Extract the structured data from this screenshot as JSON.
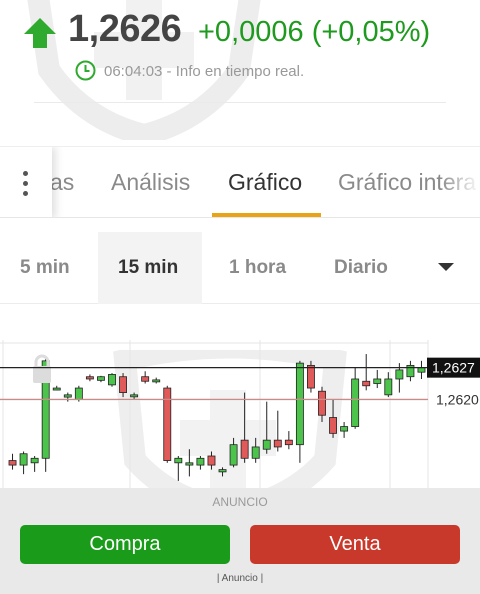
{
  "quote": {
    "price": "1,2626",
    "change": "+0,0006 (+0,05%)",
    "time": "06:04:03",
    "time_suffix": " - Info en tiempo real.",
    "trend_icon": "arrow-up-icon",
    "up_color": "#1e9a1e"
  },
  "tabs": {
    "items": [
      "as",
      "Análisis",
      "Gráfico",
      "Gráfico intera"
    ],
    "active": "Gráfico",
    "accent": "#e8a317"
  },
  "timeframes": {
    "items": [
      "5 min",
      "15 min",
      "1 hora",
      "Diario"
    ],
    "active": "15 min"
  },
  "chart_data": {
    "type": "candlestick",
    "price_labels": [
      "1,2627",
      "1,2620"
    ],
    "last_price": 1.2627,
    "reference_price": 1.262,
    "ylim": [
      1.26,
      1.2632
    ],
    "up_color": "#4cc44c",
    "down_color": "#e05a5a",
    "candles": [
      {
        "o": 1.26065,
        "h": 1.2608,
        "l": 1.26045,
        "c": 1.26055
      },
      {
        "o": 1.26055,
        "h": 1.26085,
        "l": 1.26035,
        "c": 1.2608
      },
      {
        "o": 1.2606,
        "h": 1.26075,
        "l": 1.2604,
        "c": 1.2607
      },
      {
        "o": 1.2607,
        "h": 1.2629,
        "l": 1.2604,
        "c": 1.26285
      },
      {
        "o": 1.26225,
        "h": 1.2623,
        "l": 1.2622,
        "c": 1.26225
      },
      {
        "o": 1.26205,
        "h": 1.26215,
        "l": 1.26195,
        "c": 1.2621
      },
      {
        "o": 1.262,
        "h": 1.2623,
        "l": 1.26195,
        "c": 1.26225
      },
      {
        "o": 1.2625,
        "h": 1.26255,
        "l": 1.2624,
        "c": 1.26245
      },
      {
        "o": 1.26242,
        "h": 1.26252,
        "l": 1.26238,
        "c": 1.2625
      },
      {
        "o": 1.26232,
        "h": 1.26258,
        "l": 1.26228,
        "c": 1.26255
      },
      {
        "o": 1.2625,
        "h": 1.26258,
        "l": 1.26205,
        "c": 1.26215
      },
      {
        "o": 1.2621,
        "h": 1.26215,
        "l": 1.262,
        "c": 1.2621
      },
      {
        "o": 1.2625,
        "h": 1.26262,
        "l": 1.26235,
        "c": 1.2624
      },
      {
        "o": 1.26243,
        "h": 1.26248,
        "l": 1.26235,
        "c": 1.26243
      },
      {
        "o": 1.26225,
        "h": 1.2623,
        "l": 1.2606,
        "c": 1.26065
      },
      {
        "o": 1.2606,
        "h": 1.26075,
        "l": 1.2602,
        "c": 1.2607
      },
      {
        "o": 1.26055,
        "h": 1.2609,
        "l": 1.2603,
        "c": 1.2606
      },
      {
        "o": 1.26055,
        "h": 1.26075,
        "l": 1.26045,
        "c": 1.2607
      },
      {
        "o": 1.26075,
        "h": 1.26085,
        "l": 1.26045,
        "c": 1.26055
      },
      {
        "o": 1.2604,
        "h": 1.2605,
        "l": 1.2603,
        "c": 1.26045
      },
      {
        "o": 1.26055,
        "h": 1.26115,
        "l": 1.2605,
        "c": 1.261
      },
      {
        "o": 1.2611,
        "h": 1.26215,
        "l": 1.2606,
        "c": 1.2607
      },
      {
        "o": 1.2607,
        "h": 1.26115,
        "l": 1.2606,
        "c": 1.26095
      },
      {
        "o": 1.2609,
        "h": 1.26195,
        "l": 1.2608,
        "c": 1.2611
      },
      {
        "o": 1.2611,
        "h": 1.26175,
        "l": 1.26085,
        "c": 1.26095
      },
      {
        "o": 1.2611,
        "h": 1.2613,
        "l": 1.2609,
        "c": 1.261
      },
      {
        "o": 1.261,
        "h": 1.26285,
        "l": 1.2606,
        "c": 1.2628
      },
      {
        "o": 1.26275,
        "h": 1.26285,
        "l": 1.26215,
        "c": 1.26225
      },
      {
        "o": 1.26218,
        "h": 1.26228,
        "l": 1.2615,
        "c": 1.26165
      },
      {
        "o": 1.2616,
        "h": 1.262,
        "l": 1.26115,
        "c": 1.26125
      },
      {
        "o": 1.2613,
        "h": 1.2615,
        "l": 1.26115,
        "c": 1.2614
      },
      {
        "o": 1.2614,
        "h": 1.2627,
        "l": 1.26135,
        "c": 1.26245
      },
      {
        "o": 1.2624,
        "h": 1.263,
        "l": 1.2622,
        "c": 1.2623
      },
      {
        "o": 1.26235,
        "h": 1.26265,
        "l": 1.26225,
        "c": 1.26245
      },
      {
        "o": 1.2621,
        "h": 1.2626,
        "l": 1.26205,
        "c": 1.26245
      },
      {
        "o": 1.26245,
        "h": 1.2628,
        "l": 1.26215,
        "c": 1.26265
      },
      {
        "o": 1.2625,
        "h": 1.26285,
        "l": 1.2624,
        "c": 1.26275
      },
      {
        "o": 1.2626,
        "h": 1.26285,
        "l": 1.26245,
        "c": 1.2627
      }
    ]
  },
  "actions": {
    "ad_label": "ANUNCIO",
    "buy_label": "Compra",
    "sell_label": "Venta",
    "ad_footer": "| Anuncio |",
    "buy_color": "#1a9b1a",
    "sell_color": "#c9392b"
  }
}
